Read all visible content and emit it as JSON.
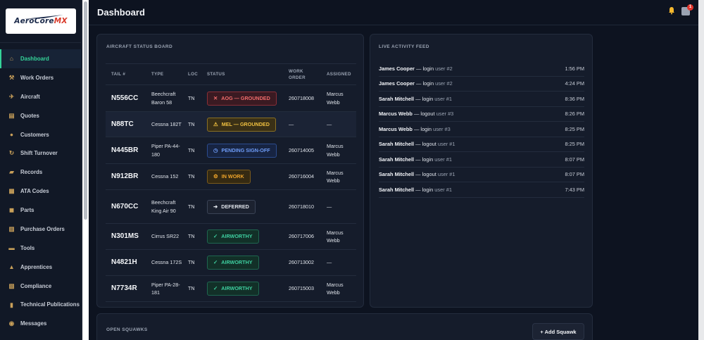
{
  "brand": {
    "logo_text": "AeroCore",
    "logo_accent": "MX"
  },
  "header": {
    "title": "Dashboard",
    "notification_count": "1"
  },
  "sidebar": {
    "items": [
      {
        "label": "Dashboard",
        "icon": "home-icon",
        "glyph": "⌂",
        "active": true
      },
      {
        "label": "Work Orders",
        "icon": "wrench-icon",
        "glyph": "⚒"
      },
      {
        "label": "Aircraft",
        "icon": "airplane-icon",
        "glyph": "✈"
      },
      {
        "label": "Quotes",
        "icon": "clipboard-icon",
        "glyph": "▤"
      },
      {
        "label": "Customers",
        "icon": "user-icon",
        "glyph": "●"
      },
      {
        "label": "Shift Turnover",
        "icon": "refresh-icon",
        "glyph": "↻"
      },
      {
        "label": "Records",
        "icon": "folder-icon",
        "glyph": "▰"
      },
      {
        "label": "ATA Codes",
        "icon": "code-grid-icon",
        "glyph": "▦"
      },
      {
        "label": "Parts",
        "icon": "box-icon",
        "glyph": "◼"
      },
      {
        "label": "Purchase Orders",
        "icon": "document-icon",
        "glyph": "▥"
      },
      {
        "label": "Tools",
        "icon": "toolbox-icon",
        "glyph": "▬"
      },
      {
        "label": "Apprentices",
        "icon": "graduation-cap-icon",
        "glyph": "▲"
      },
      {
        "label": "Compliance",
        "icon": "scroll-icon",
        "glyph": "▧"
      },
      {
        "label": "Technical Publications",
        "icon": "books-icon",
        "glyph": "▮"
      },
      {
        "label": "Messages",
        "icon": "chat-bubble-icon",
        "glyph": "◉"
      }
    ]
  },
  "status_board": {
    "title": "AIRCRAFT STATUS BOARD",
    "columns": {
      "tail": "TAIL #",
      "type": "TYPE",
      "loc": "LOC",
      "status": "STATUS",
      "work_order": "WORK ORDER",
      "assigned": "ASSIGNED"
    },
    "rows": [
      {
        "tail": "N556CC",
        "type": "Beechcraft Baron 58",
        "loc": "TN",
        "status": "AOG — GROUNDED",
        "status_kind": "aog",
        "status_glyph": "✕",
        "work_order": "260718008",
        "assigned": "Marcus Webb"
      },
      {
        "tail": "N88TC",
        "type": "Cessna 182T",
        "loc": "TN",
        "status": "MEL — GROUNDED",
        "status_kind": "mel",
        "status_glyph": "⚠",
        "work_order": "—",
        "assigned": "—"
      },
      {
        "tail": "N445BR",
        "type": "Piper PA-44-180",
        "loc": "TN",
        "status": "PENDING SIGN-OFF",
        "status_kind": "pend",
        "status_glyph": "◷",
        "work_order": "260714005",
        "assigned": "Marcus Webb"
      },
      {
        "tail": "N912BR",
        "type": "Cessna 152",
        "loc": "TN",
        "status": "IN WORK",
        "status_kind": "work",
        "status_glyph": "⚙",
        "work_order": "260716004",
        "assigned": "Marcus Webb"
      },
      {
        "tail": "N670CC",
        "type": "Beechcraft King Air 90",
        "loc": "TN",
        "status": "DEFERRED",
        "status_kind": "def",
        "status_glyph": "➜",
        "work_order": "260718010",
        "assigned": "—"
      },
      {
        "tail": "N301MS",
        "type": "Cirrus SR22",
        "loc": "TN",
        "status": "AIRWORTHY",
        "status_kind": "air",
        "status_glyph": "✓",
        "work_order": "260717006",
        "assigned": "Marcus Webb"
      },
      {
        "tail": "N4821H",
        "type": "Cessna 172S",
        "loc": "TN",
        "status": "AIRWORTHY",
        "status_kind": "air",
        "status_glyph": "✓",
        "work_order": "260713002",
        "assigned": "—"
      },
      {
        "tail": "N7734R",
        "type": "Piper PA-28-181",
        "loc": "TN",
        "status": "AIRWORTHY",
        "status_kind": "air",
        "status_glyph": "✓",
        "work_order": "260715003",
        "assigned": "Marcus Webb"
      }
    ]
  },
  "activity_feed": {
    "title": "LIVE ACTIVITY FEED",
    "items": [
      {
        "who": "James Cooper",
        "action": "— login",
        "user": "user #2",
        "time": "1:56 PM"
      },
      {
        "who": "James Cooper",
        "action": "— login",
        "user": "user #2",
        "time": "4:24 PM"
      },
      {
        "who": "Sarah Mitchell",
        "action": "— login",
        "user": "user #1",
        "time": "8:36 PM"
      },
      {
        "who": "Marcus Webb",
        "action": "— logout",
        "user": "user #3",
        "time": "8:26 PM"
      },
      {
        "who": "Marcus Webb",
        "action": "— login",
        "user": "user #3",
        "time": "8:25 PM"
      },
      {
        "who": "Sarah Mitchell",
        "action": "— logout",
        "user": "user #1",
        "time": "8:25 PM"
      },
      {
        "who": "Sarah Mitchell",
        "action": "— login",
        "user": "user #1",
        "time": "8:07 PM"
      },
      {
        "who": "Sarah Mitchell",
        "action": "— logout",
        "user": "user #1",
        "time": "8:07 PM"
      },
      {
        "who": "Sarah Mitchell",
        "action": "— login",
        "user": "user #1",
        "time": "7:43 PM"
      }
    ]
  },
  "squawks": {
    "title": "OPEN SQUAWKS",
    "add_label": "+ Add Squawk"
  },
  "colors": {
    "accent": "#34d399",
    "background": "#0d1320",
    "card": "#151c2b",
    "danger": "#e0342b"
  }
}
